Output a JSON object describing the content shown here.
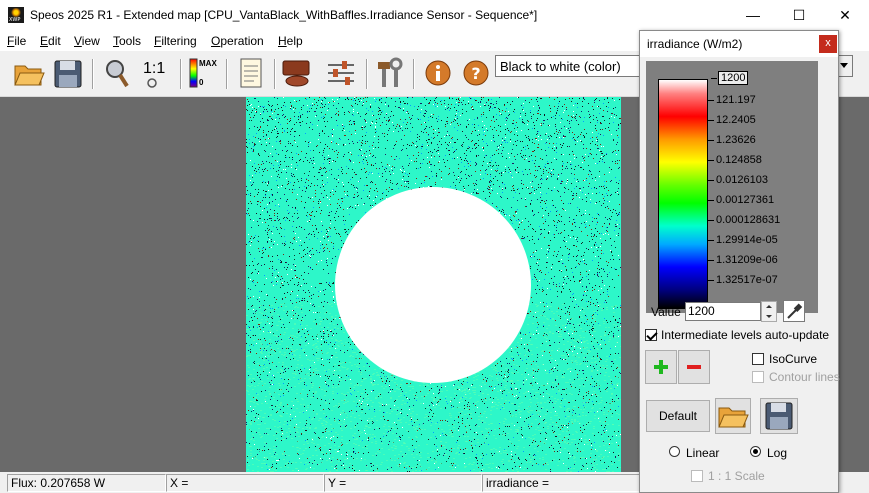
{
  "window": {
    "title": "Speos 2025 R1 - Extended map [CPU_VantaBlack_WithBaffles.Irradiance Sensor - Sequence*]",
    "minimize": "—",
    "maximize": "☐",
    "close": "✕"
  },
  "menu": [
    {
      "u": "F",
      "rest": "ile"
    },
    {
      "u": "E",
      "rest": "dit"
    },
    {
      "u": "V",
      "rest": "iew"
    },
    {
      "u": "T",
      "rest": "ools"
    },
    {
      "u": "F",
      "rest": "iltering"
    },
    {
      "u": "O",
      "rest": "peration"
    },
    {
      "u": "H",
      "rest": "elp"
    }
  ],
  "toolbar": {
    "zoom_one_label": "1:1",
    "levels_max": "MAX",
    "levels_min": "0",
    "palette_combo": "Black to white (color)"
  },
  "status": {
    "flux": "Flux: 0.207658 W",
    "x": "X =",
    "y": "Y =",
    "value": "irradiance ="
  },
  "palette": {
    "title": "irradiance (W/m2)",
    "close": "x",
    "levels": [
      "1200",
      "121.197",
      "12.2405",
      "1.23626",
      "0.124858",
      "0.0126103",
      "0.00127361",
      "0.000128631",
      "1.29914e-05",
      "1.31209e-06",
      "1.32517e-07"
    ],
    "value_label": "Value",
    "value": "1200",
    "auto_update_label": "Intermediate levels auto-update",
    "auto_update_checked": true,
    "isocurve_label": "IsoCurve",
    "contour_label": "Contour lines",
    "default_label": "Default",
    "linear_label": "Linear",
    "log_label": "Log",
    "scale_label": "1 : 1 Scale",
    "scale_mode": "log"
  },
  "colors": {
    "map_base": "#2df7c9",
    "accent_red": "#c42b1c"
  }
}
